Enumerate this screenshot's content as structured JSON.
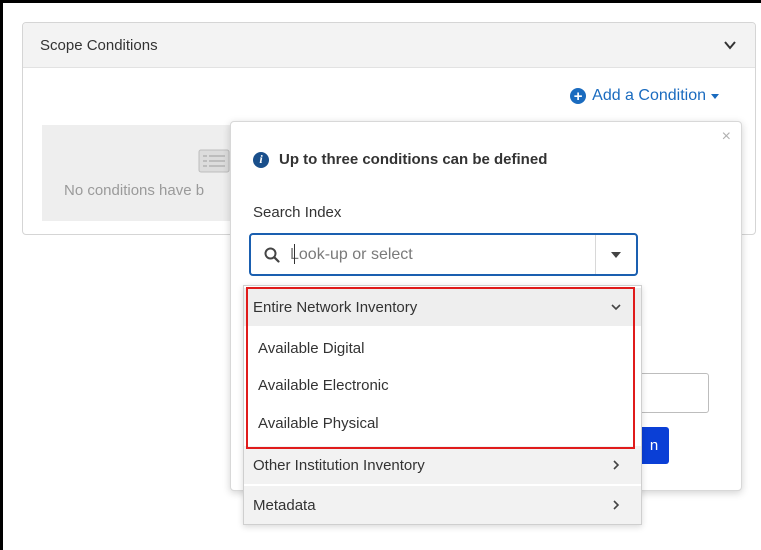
{
  "panel": {
    "title": "Scope Conditions",
    "add_condition_label": "Add a Condition",
    "empty_text": "No conditions have b"
  },
  "popover": {
    "close_glyph": "×",
    "info_text": "Up to three conditions can be defined",
    "field_label": "Search Index",
    "behind_button_label": "n"
  },
  "combo": {
    "placeholder": "Look-up or select",
    "value": ""
  },
  "dropdown": {
    "groups": [
      {
        "label": "Entire Network Inventory",
        "expanded": true,
        "options": [
          "Available Digital",
          "Available Electronic",
          "Available Physical"
        ]
      },
      {
        "label": "Other Institution Inventory",
        "expanded": false
      },
      {
        "label": "Metadata",
        "expanded": false
      }
    ]
  },
  "colors": {
    "accent_blue": "#1a6bbf",
    "highlight_red": "#e01b1b",
    "primary_button": "#0a3fd6"
  },
  "icons": {
    "collapse": "chevron-down-icon",
    "add": "plus-circle-icon",
    "empty": "list-icon",
    "info": "info-icon",
    "search": "search-icon",
    "expand": "chevron-right-icon"
  }
}
